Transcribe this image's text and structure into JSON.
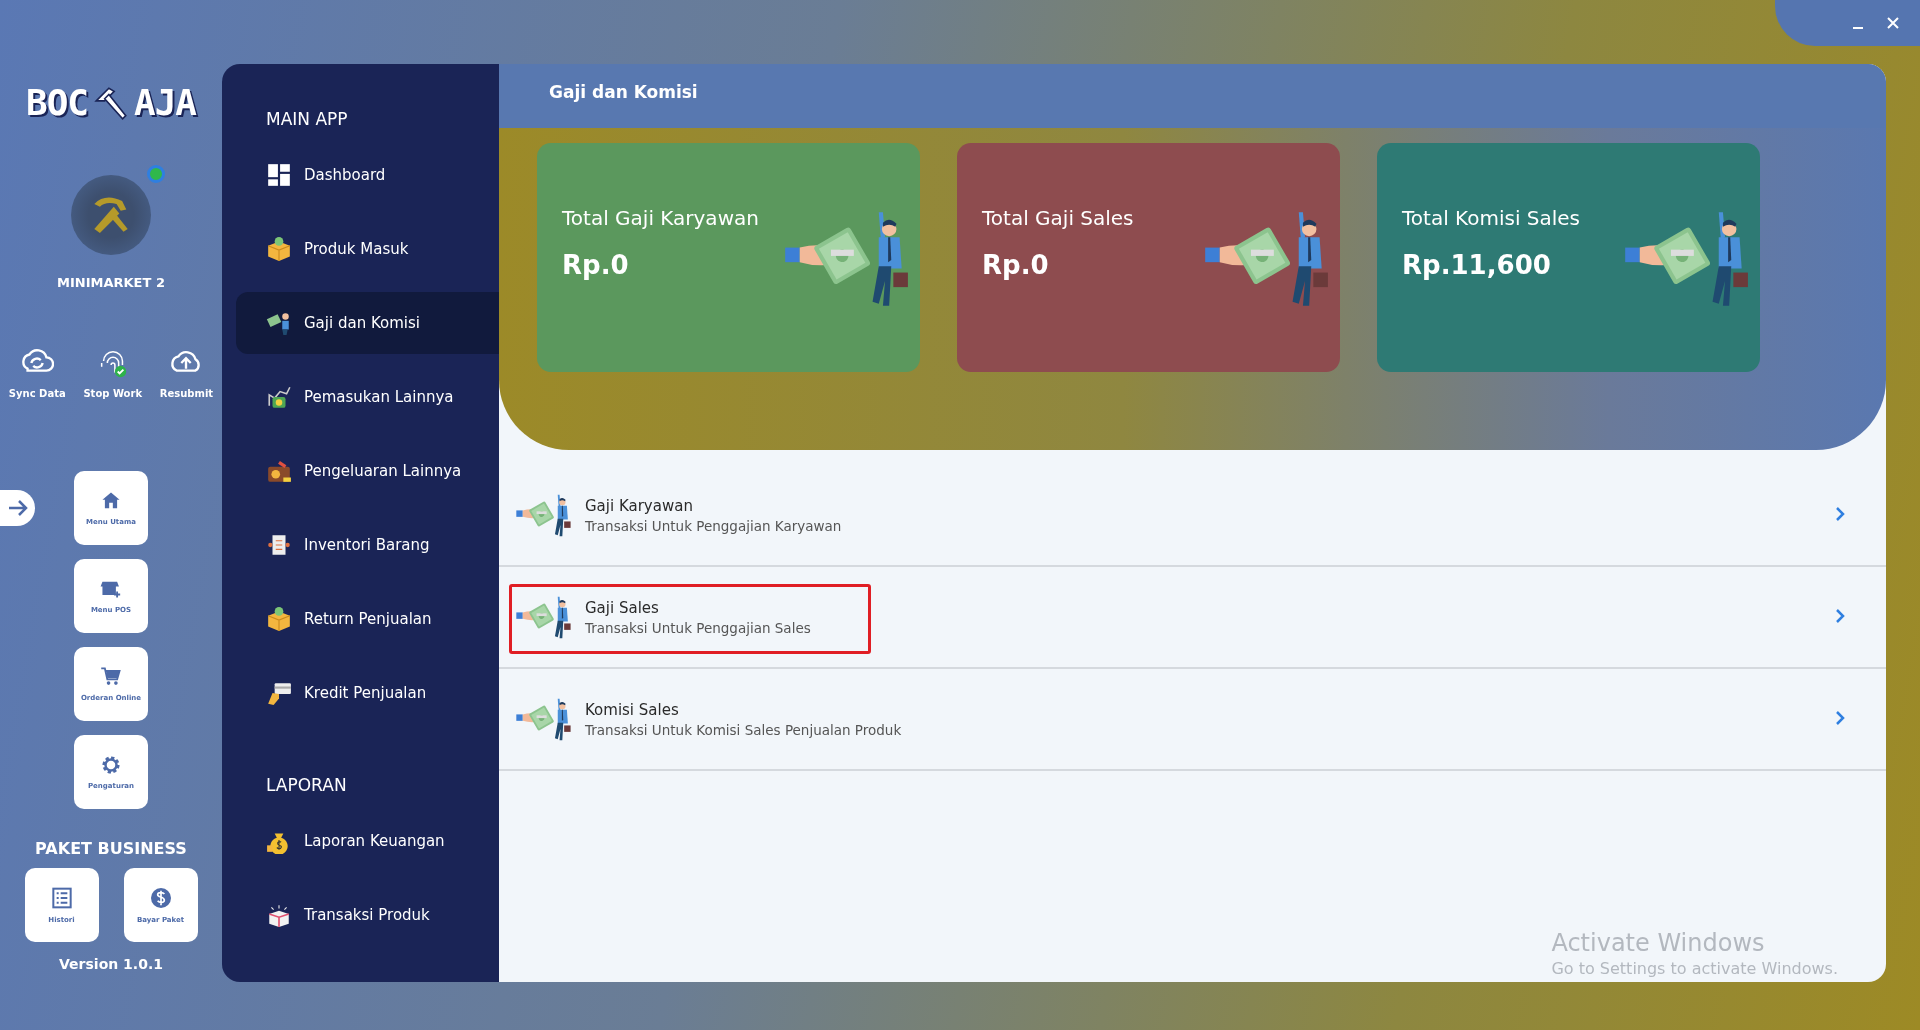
{
  "brand": {
    "left": "BOC",
    "right": "AJA"
  },
  "store": {
    "name": "MINIMARKET 2",
    "online": true
  },
  "quick_actions": [
    {
      "label": "Sync Data",
      "kind": "sync"
    },
    {
      "label": "Stop Work",
      "kind": "fingerprint"
    },
    {
      "label": "Resubmit",
      "kind": "upload"
    }
  ],
  "menu_tiles": [
    {
      "label": "Menu Utama",
      "kind": "home"
    },
    {
      "label": "Menu POS",
      "kind": "store"
    },
    {
      "label": "Orderan Online",
      "kind": "cart"
    },
    {
      "label": "Pengaturan",
      "kind": "gear"
    }
  ],
  "plan": {
    "title": "PAKET BUSINESS",
    "tiles": [
      {
        "label": "Histori",
        "kind": "list"
      },
      {
        "label": "Bayar Paket",
        "kind": "dollar"
      }
    ]
  },
  "version": "Version 1.0.1",
  "sidebar": {
    "sections": [
      {
        "title": "MAIN APP",
        "items": [
          {
            "label": "Dashboard",
            "kind": "dashboard",
            "selected": false
          },
          {
            "label": "Produk Masuk",
            "kind": "box",
            "selected": false
          },
          {
            "label": "Gaji dan Komisi",
            "kind": "money",
            "selected": true
          },
          {
            "label": "Pemasukan Lainnya",
            "kind": "chart",
            "selected": false
          },
          {
            "label": "Pengeluaran Lainnya",
            "kind": "wallet",
            "selected": false
          },
          {
            "label": "Inventori Barang",
            "kind": "clipboard",
            "selected": false
          },
          {
            "label": "Return Penjualan",
            "kind": "box",
            "selected": false
          },
          {
            "label": "Kredit Penjualan",
            "kind": "card",
            "selected": false
          }
        ]
      },
      {
        "title": "LAPORAN",
        "items": [
          {
            "label": "Laporan Keuangan",
            "kind": "moneybag",
            "selected": false
          },
          {
            "label": "Transaksi Produk",
            "kind": "gift",
            "selected": false
          }
        ]
      }
    ]
  },
  "page_title": "Gaji dan Komisi",
  "cards": [
    {
      "title": "Total Gaji Karyawan",
      "value": "Rp.0",
      "color": "#5b985d"
    },
    {
      "title": "Total Gaji Sales",
      "value": "Rp.0",
      "color": "#8e4c4f"
    },
    {
      "title": "Total Komisi Sales",
      "value": "Rp.11,600",
      "color": "#2e7a74"
    }
  ],
  "rows": [
    {
      "title": "Gaji Karyawan",
      "subtitle": "Transaksi Untuk Penggajian Karyawan",
      "highlighted": false
    },
    {
      "title": "Gaji Sales",
      "subtitle": "Transaksi Untuk Penggajian Sales",
      "highlighted": true
    },
    {
      "title": "Komisi Sales",
      "subtitle": "Transaksi Untuk Komisi Sales Penjualan Produk",
      "highlighted": false
    }
  ],
  "watermark": {
    "title": "Activate Windows",
    "text": "Go to Settings to activate Windows."
  }
}
